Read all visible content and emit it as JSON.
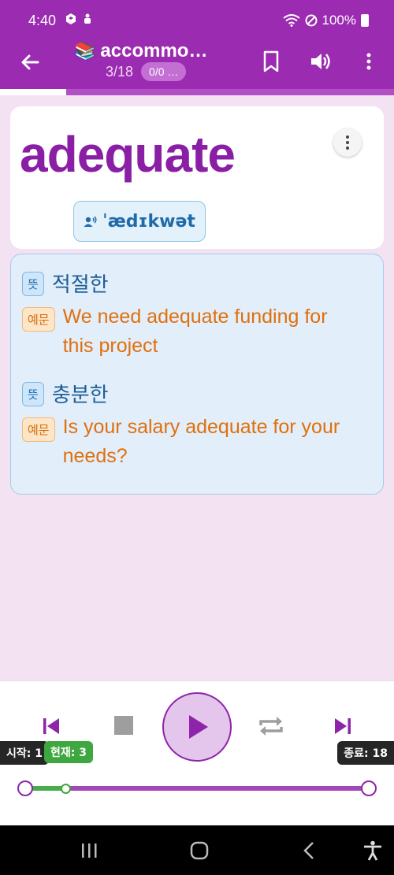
{
  "status": {
    "time": "4:40",
    "battery": "100%",
    "left_icons": [
      "app-icon",
      "notification-icon"
    ],
    "right_icons": [
      "wifi-icon",
      "dnd-icon",
      "battery-icon"
    ]
  },
  "app_bar": {
    "title_emoji": "📚",
    "title": "accommo…",
    "progress_count": "3/18",
    "progress_chip": "0/0 …",
    "icons": [
      "back-arrow-icon",
      "bookmark-icon",
      "volume-icon",
      "more-vert-icon"
    ]
  },
  "progress_strip": {
    "fraction": 0.167
  },
  "word_card": {
    "word": "adequate",
    "pronunciation": "ˈædɪkwət"
  },
  "meanings": [
    {
      "meaning_tag": "뜻",
      "meaning": "적절한",
      "example_tag": "예문",
      "example": "We need adequate funding for this project"
    },
    {
      "meaning_tag": "뜻",
      "meaning": "충분한",
      "example_tag": "예문",
      "example": "Is your salary adequate for your needs?"
    }
  ],
  "player": {
    "start_label": "시작: 1",
    "current_label": "현재: 3",
    "end_label": "종료: 18",
    "slider": {
      "min": 1,
      "max": 18,
      "start": 1,
      "current": 3,
      "end": 18
    },
    "colors": {
      "accent": "#8e24aa",
      "current": "#3fa73f"
    }
  },
  "colors": {
    "primary": "#9b2bb0",
    "word": "#8a1fa6",
    "meaning": "#1d5e98",
    "example": "#e0700c",
    "background": "#f3e2f2"
  }
}
